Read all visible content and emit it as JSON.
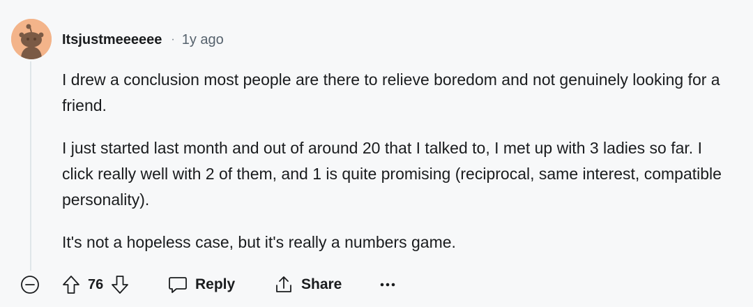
{
  "comment": {
    "author": "Itsjustmeeeeee",
    "separator": "·",
    "timestamp": "1y ago",
    "paragraphs": [
      "I drew a conclusion most people are there to relieve boredom and not genuinely looking for a friend.",
      "I just started last month and out of around 20 that I talked to, I met up with 3 ladies so far. I click really well with 2 of them, and 1 is quite promising (reciprocal, same interest, compatible personality).",
      "It's not a hopeless case, but it's really a numbers game."
    ]
  },
  "actions": {
    "collapse_icon": "minus-circle-icon",
    "upvote_icon": "arrow-up-icon",
    "score": "76",
    "downvote_icon": "arrow-down-icon",
    "reply_icon": "speech-bubble-icon",
    "reply_label": "Reply",
    "share_icon": "share-icon",
    "share_label": "Share",
    "more_icon": "ellipsis-icon"
  },
  "colors": {
    "background": "#f7f8f9",
    "avatar_bg": "#f3b48a",
    "text": "#1a1c1e",
    "muted": "#56626d",
    "thread_line": "#dfe6e9"
  }
}
